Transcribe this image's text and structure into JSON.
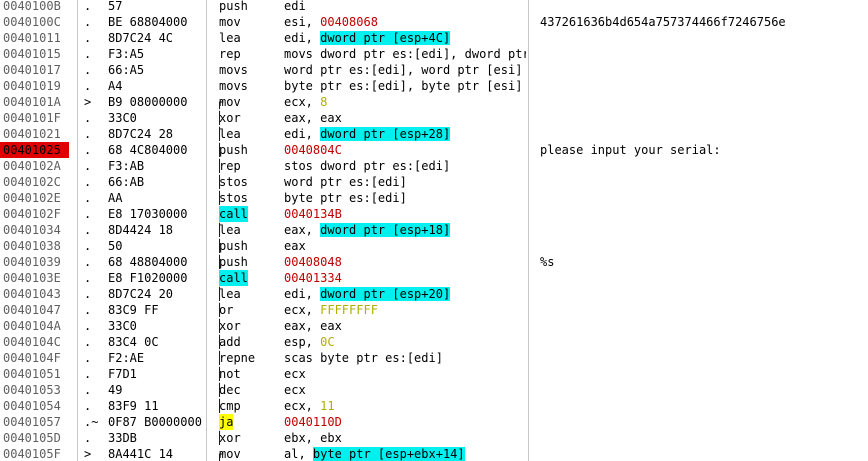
{
  "colors": {
    "current_address_bg": "#e00000",
    "call_highlight": "#00f0f0",
    "jump_highlight": "#ffff00",
    "constant_color": "#b0b000",
    "address_color": "#c00000",
    "memory_operand_color": "#0000c0"
  },
  "rows": [
    {
      "addr": "0040100B",
      "mark": ".",
      "hex": "57",
      "brace": "",
      "mnem": "push",
      "mnem_style": "",
      "operand": "edi",
      "op_style": "",
      "comment": ""
    },
    {
      "addr": "0040100C",
      "mark": ".",
      "hex": "BE 68804000",
      "brace": "",
      "mnem": "mov",
      "mnem_style": "",
      "operand": "esi, 00408068",
      "op_style": "",
      "comment": "437261636b4d654a757374466f7246756e"
    },
    {
      "addr": "00401011",
      "mark": ".",
      "hex": "8D7C24 4C",
      "brace": "",
      "mnem": "lea",
      "mnem_style": "",
      "operand": "edi, dword ptr [esp+4C]",
      "op_style": "",
      "comment": ""
    },
    {
      "addr": "00401015",
      "mark": ".",
      "hex": "F3:A5",
      "brace": "",
      "mnem": "rep",
      "mnem_style": "",
      "operand": "movs dword ptr es:[edi], dword ptr",
      "op_style": "",
      "comment": ""
    },
    {
      "addr": "00401017",
      "mark": ".",
      "hex": "66:A5",
      "brace": "",
      "mnem": "movs",
      "mnem_style": "",
      "operand": "word ptr es:[edi], word ptr [esi]",
      "op_style": "",
      "comment": ""
    },
    {
      "addr": "00401019",
      "mark": ".",
      "hex": "A4",
      "brace": "",
      "mnem": "movs",
      "mnem_style": "",
      "operand": "byte ptr es:[edi], byte ptr [esi]",
      "op_style": "",
      "comment": ""
    },
    {
      "addr": "0040101A",
      "mark": ">",
      "hex": "B9 08000000",
      "brace": "┌",
      "mnem": "mov",
      "mnem_style": "",
      "operand": "ecx, 8",
      "op_style": "",
      "comment": ""
    },
    {
      "addr": "0040101F",
      "mark": ".",
      "hex": "33C0",
      "brace": "│",
      "mnem": "xor",
      "mnem_style": "",
      "operand": "eax, eax",
      "op_style": "",
      "comment": ""
    },
    {
      "addr": "00401021",
      "mark": ".",
      "hex": "8D7C24 28",
      "brace": "│",
      "mnem": "lea",
      "mnem_style": "",
      "operand": "edi, dword ptr [esp+28]",
      "op_style": "",
      "comment": ""
    },
    {
      "addr": "00401025",
      "mark": ".",
      "hex": "68 4C804000",
      "brace": "│",
      "mnem": "push",
      "mnem_style": "",
      "operand": "0040804C",
      "op_style": "",
      "comment": "please input your serial:",
      "current": true
    },
    {
      "addr": "0040102A",
      "mark": ".",
      "hex": "F3:AB",
      "brace": "│",
      "mnem": "rep",
      "mnem_style": "",
      "operand": "stos dword ptr es:[edi]",
      "op_style": "",
      "comment": ""
    },
    {
      "addr": "0040102C",
      "mark": ".",
      "hex": "66:AB",
      "brace": "│",
      "mnem": "stos",
      "mnem_style": "",
      "operand": "word ptr es:[edi]",
      "op_style": "",
      "comment": ""
    },
    {
      "addr": "0040102E",
      "mark": ".",
      "hex": "AA",
      "brace": "│",
      "mnem": "stos",
      "mnem_style": "",
      "operand": "byte ptr es:[edi]",
      "op_style": "",
      "comment": ""
    },
    {
      "addr": "0040102F",
      "mark": ".",
      "hex": "E8 17030000",
      "brace": "│",
      "mnem": "call",
      "mnem_style": "cyan",
      "operand": "0040134B",
      "op_style": "",
      "comment": ""
    },
    {
      "addr": "00401034",
      "mark": ".",
      "hex": "8D4424 18",
      "brace": "│",
      "mnem": "lea",
      "mnem_style": "",
      "operand": "eax, dword ptr [esp+18]",
      "op_style": "",
      "comment": ""
    },
    {
      "addr": "00401038",
      "mark": ".",
      "hex": "50",
      "brace": "│",
      "mnem": "push",
      "mnem_style": "",
      "operand": "eax",
      "op_style": "",
      "comment": ""
    },
    {
      "addr": "00401039",
      "mark": ".",
      "hex": "68 48804000",
      "brace": "│",
      "mnem": "push",
      "mnem_style": "",
      "operand": "00408048",
      "op_style": "",
      "comment": "%s"
    },
    {
      "addr": "0040103E",
      "mark": ".",
      "hex": "E8 F1020000",
      "brace": "│",
      "mnem": "call",
      "mnem_style": "cyan",
      "operand": "00401334",
      "op_style": "",
      "comment": ""
    },
    {
      "addr": "00401043",
      "mark": ".",
      "hex": "8D7C24 20",
      "brace": "│",
      "mnem": "lea",
      "mnem_style": "",
      "operand": "edi, dword ptr [esp+20]",
      "op_style": "",
      "comment": ""
    },
    {
      "addr": "00401047",
      "mark": ".",
      "hex": "83C9 FF",
      "brace": "│",
      "mnem": "or",
      "mnem_style": "",
      "operand": "ecx, FFFFFFFF",
      "op_style": "",
      "comment": ""
    },
    {
      "addr": "0040104A",
      "mark": ".",
      "hex": "33C0",
      "brace": "│",
      "mnem": "xor",
      "mnem_style": "",
      "operand": "eax, eax",
      "op_style": "",
      "comment": ""
    },
    {
      "addr": "0040104C",
      "mark": ".",
      "hex": "83C4 0C",
      "brace": "│",
      "mnem": "add",
      "mnem_style": "",
      "operand": "esp, 0C",
      "op_style": "",
      "comment": ""
    },
    {
      "addr": "0040104F",
      "mark": ".",
      "hex": "F2:AE",
      "brace": "│",
      "mnem": "repne",
      "mnem_style": "",
      "operand": "scas byte ptr es:[edi]",
      "op_style": "",
      "comment": ""
    },
    {
      "addr": "00401051",
      "mark": ".",
      "hex": "F7D1",
      "brace": "│",
      "mnem": "not",
      "mnem_style": "",
      "operand": "ecx",
      "op_style": "",
      "comment": ""
    },
    {
      "addr": "00401053",
      "mark": ".",
      "hex": "49",
      "brace": "│",
      "mnem": "dec",
      "mnem_style": "",
      "operand": "ecx",
      "op_style": "",
      "comment": ""
    },
    {
      "addr": "00401054",
      "mark": ".",
      "hex": "83F9 11",
      "brace": "│",
      "mnem": "cmp",
      "mnem_style": "",
      "operand": "ecx, 11",
      "op_style": "",
      "comment": ""
    },
    {
      "addr": "00401057",
      "mark": ".~",
      "hex": "0F87 B0000000",
      "brace": "│",
      "mnem": "ja",
      "mnem_style": "yellow",
      "operand": "0040110D",
      "op_style": "",
      "comment": ""
    },
    {
      "addr": "0040105D",
      "mark": ".",
      "hex": "33DB",
      "brace": "│",
      "mnem": "xor",
      "mnem_style": "",
      "operand": "ebx, ebx",
      "op_style": "",
      "comment": ""
    },
    {
      "addr": "0040105F",
      "mark": ">",
      "hex": "8A441C 14",
      "brace": "┌",
      "mnem": "mov",
      "mnem_style": "",
      "operand": "al, byte ptr [esp+ebx+14]",
      "op_style": "",
      "comment": ""
    }
  ]
}
